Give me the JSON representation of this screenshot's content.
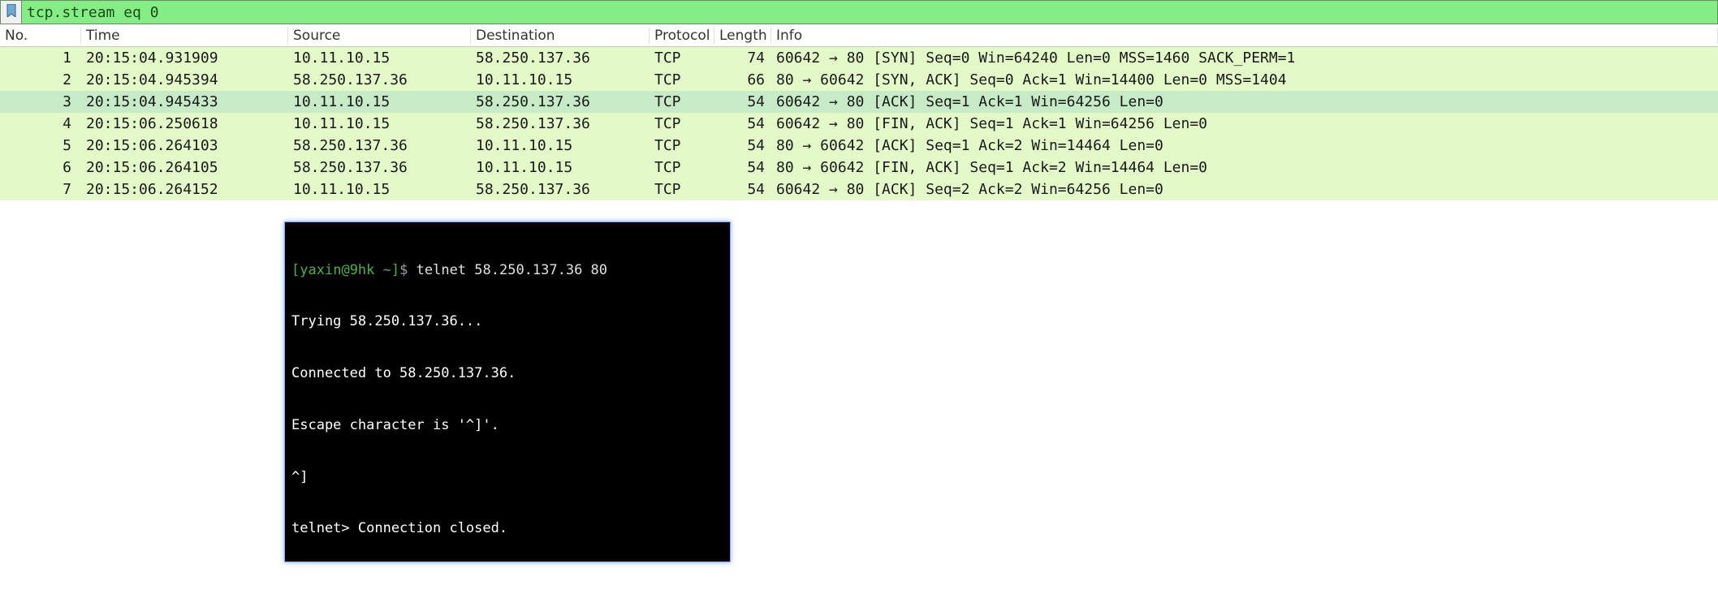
{
  "filter": {
    "value": "tcp.stream eq 0"
  },
  "columns": {
    "no": "No.",
    "time": "Time",
    "source": "Source",
    "destination": "Destination",
    "protocol": "Protocol",
    "length": "Length",
    "info": "Info"
  },
  "packets": [
    {
      "no": "1",
      "time": "20:15:04.931909",
      "src": "10.11.10.15",
      "dst": "58.250.137.36",
      "proto": "TCP",
      "len": "74",
      "info": "60642 → 80 [SYN] Seq=0 Win=64240 Len=0 MSS=1460 SACK_PERM=1"
    },
    {
      "no": "2",
      "time": "20:15:04.945394",
      "src": "58.250.137.36",
      "dst": "10.11.10.15",
      "proto": "TCP",
      "len": "66",
      "info": "80 → 60642 [SYN, ACK] Seq=0 Ack=1 Win=14400 Len=0 MSS=1404"
    },
    {
      "no": "3",
      "time": "20:15:04.945433",
      "src": "10.11.10.15",
      "dst": "58.250.137.36",
      "proto": "TCP",
      "len": "54",
      "info": "60642 → 80 [ACK] Seq=1 Ack=1 Win=64256 Len=0"
    },
    {
      "no": "4",
      "time": "20:15:06.250618",
      "src": "10.11.10.15",
      "dst": "58.250.137.36",
      "proto": "TCP",
      "len": "54",
      "info": "60642 → 80 [FIN, ACK] Seq=1 Ack=1 Win=64256 Len=0"
    },
    {
      "no": "5",
      "time": "20:15:06.264103",
      "src": "58.250.137.36",
      "dst": "10.11.10.15",
      "proto": "TCP",
      "len": "54",
      "info": "80 → 60642 [ACK] Seq=1 Ack=2 Win=14464 Len=0"
    },
    {
      "no": "6",
      "time": "20:15:06.264105",
      "src": "58.250.137.36",
      "dst": "10.11.10.15",
      "proto": "TCP",
      "len": "54",
      "info": "80 → 60642 [FIN, ACK] Seq=1 Ack=2 Win=14464 Len=0"
    },
    {
      "no": "7",
      "time": "20:15:06.264152",
      "src": "10.11.10.15",
      "dst": "58.250.137.36",
      "proto": "TCP",
      "len": "54",
      "info": "60642 → 80 [ACK] Seq=2 Ack=2 Win=64256 Len=0"
    }
  ],
  "selected_index": 2,
  "terminal": {
    "prompt": {
      "open": "[",
      "user": "yaxin",
      "at": "@",
      "host": "9hk",
      "path": " ~",
      "close": "]",
      "dollar": "$ "
    },
    "command": "telnet 58.250.137.36 80",
    "lines": [
      "Trying 58.250.137.36...",
      "Connected to 58.250.137.36.",
      "Escape character is '^]'.",
      "^]",
      "telnet> Connection closed."
    ]
  }
}
